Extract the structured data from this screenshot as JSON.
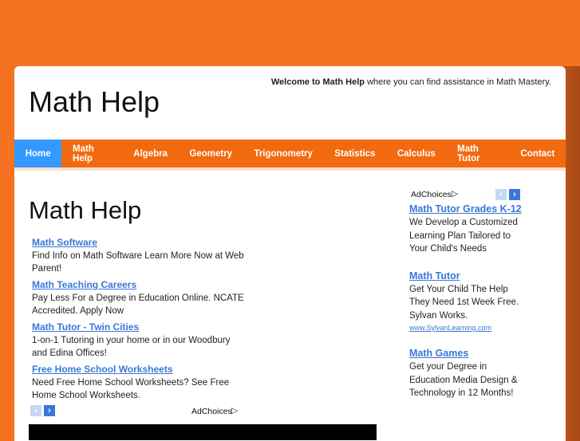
{
  "header": {
    "welcome_bold": "Welcome to Math Help",
    "welcome_rest": " where you can find assistance in Math Mastery.",
    "site_title": "Math Help"
  },
  "nav": [
    "Home",
    "Math Help",
    "Algebra",
    "Geometry",
    "Trigonometry",
    "Statistics",
    "Calculus",
    "Math Tutor",
    "Contact"
  ],
  "main": {
    "title": "Math Help"
  },
  "ads_left": [
    {
      "title": "Math Software",
      "text": "Find Info on Math Software Learn More Now at Web Parent!"
    },
    {
      "title": "Math Teaching Careers",
      "text": "Pay Less For a Degree in Education Online. NCATE Accredited. Apply Now"
    },
    {
      "title": "Math Tutor - Twin Cities",
      "text": "1-on-1 Tutoring in your home or in our Woodbury and Edina Offices!"
    },
    {
      "title": "Free Home School Worksheets",
      "text": "Need Free Home School Worksheets? See Free Home School Worksheets."
    }
  ],
  "adchoices": "AdChoices",
  "ads_right": [
    {
      "title": "Math Tutor Grades K-12",
      "text": "We Develop a Customized Learning Plan Tailored to Your Child's Needs"
    },
    {
      "title": "Math Tutor",
      "text": "Get Your Child The Help They Need 1st Week Free. Sylvan Works.",
      "url": "www.SylvanLearning.com"
    },
    {
      "title": "Math Games",
      "text": "Get your Degree in Education Media Design & Technology in 12 Months!"
    }
  ]
}
